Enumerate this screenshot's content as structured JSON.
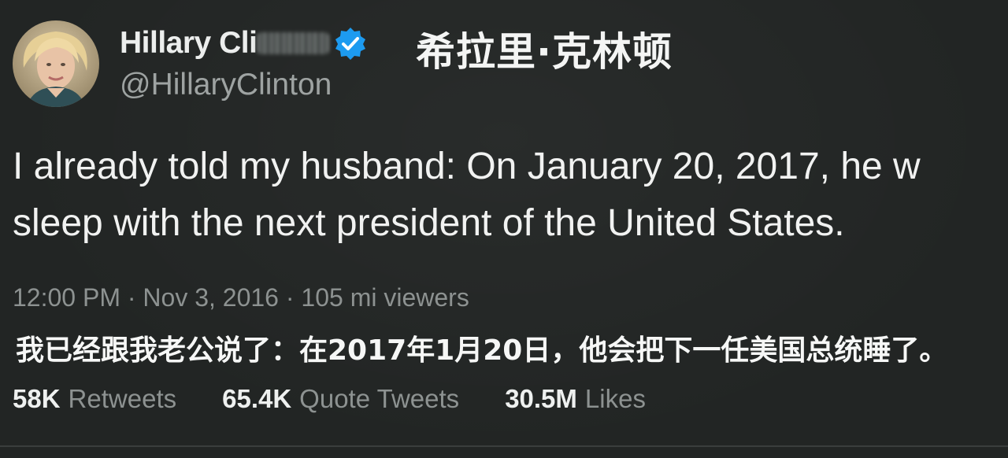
{
  "author": {
    "display_name": "Hillary Cli",
    "handle": "@HillaryClinton",
    "avatar_icon": "person-portrait-icon",
    "verified_icon": "verified-badge-icon",
    "verified_color": "#1d9bf0"
  },
  "overlay": {
    "cn_name": "希拉里·克林顿",
    "cn_translation": "我已经跟我老公说了：在2017年1月20日，他会把下一任美国总统睡了。"
  },
  "tweet": {
    "line1": "I already told my husband: On January 20, 2017, he w",
    "line2": "sleep with the next president of the United States."
  },
  "meta": {
    "text": "12:00 PM · Nov 3, 2016 · 105 mi viewers"
  },
  "stats": {
    "retweets_count": "58K",
    "retweets_label": "Retweets",
    "quote_count": "65.4K",
    "quote_label": "Quote Tweets",
    "likes_count": "30.5M",
    "likes_label": "Likes"
  }
}
